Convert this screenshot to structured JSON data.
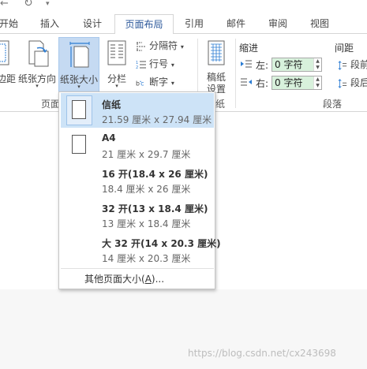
{
  "qat": {
    "undo_glyph": "←",
    "redo_glyph": "↻",
    "more_glyph": "▾"
  },
  "tabs": [
    {
      "label": "开始"
    },
    {
      "label": "插入"
    },
    {
      "label": "设计"
    },
    {
      "label": "页面布局",
      "active": true
    },
    {
      "label": "引用"
    },
    {
      "label": "邮件"
    },
    {
      "label": "审阅"
    },
    {
      "label": "视图"
    }
  ],
  "ribbon": {
    "margins_label": "边距",
    "orientation_label": "纸张方向",
    "size_label": "纸张大小",
    "columns_label": "分栏",
    "breaks_label": "分隔符",
    "line_numbers_label": "行号",
    "hyphenation_label": "断字",
    "draft_label_1": "稿纸",
    "draft_label_2": "设置",
    "group_page_label": "页面",
    "group_draft_label": "纸",
    "indent_title": "缩进",
    "spacing_title": "间距",
    "indent_left_label": "左:",
    "indent_left_value": "0 字符",
    "indent_right_label": "右:",
    "indent_right_value": "0 字符",
    "spacing_before_label": "段前",
    "spacing_after_label": "段后",
    "group_paragraph_label": "段落",
    "caret": "▾"
  },
  "dropdown": {
    "items": [
      {
        "title": "信纸",
        "size": "21.59 厘米 x 27.94 厘米",
        "selected": true
      },
      {
        "title": "A4",
        "size": "21 厘米 x 29.7 厘米"
      },
      {
        "title": "16 开(18.4 x 26 厘米)",
        "size": "18.4 厘米 x 26 厘米"
      },
      {
        "title": "32 开(13 x 18.4 厘米)",
        "size": "13 厘米 x 18.4 厘米"
      },
      {
        "title": "大 32 开(14 x 20.3 厘米)",
        "size": "14 厘米 x 20.3 厘米"
      }
    ],
    "more_prefix": "其他页面大小(",
    "more_key": "A",
    "more_suffix": ")..."
  },
  "watermark": "https://blog.csdn.net/cx243698",
  "colors": {
    "accent": "#2b579a",
    "hover": "#c5daf2",
    "selected": "#cde3f7",
    "spin_bg": "#d8f1dc"
  }
}
